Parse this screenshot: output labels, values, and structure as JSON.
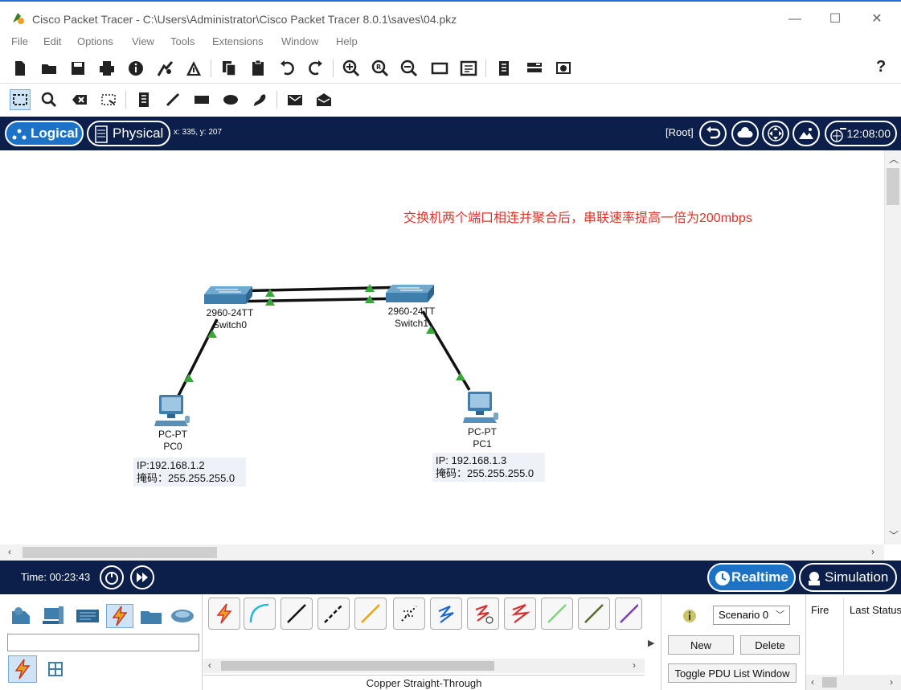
{
  "window": {
    "title": "Cisco Packet Tracer - C:\\Users\\Administrator\\Cisco Packet Tracer 8.0.1\\saves\\04.pkz",
    "minimize": "—",
    "maximize": "☐",
    "close": "✕"
  },
  "menu": [
    "File",
    "Edit",
    "Options",
    "View",
    "Tools",
    "Extensions",
    "Window",
    "Help"
  ],
  "toolbar": {
    "help": "?"
  },
  "workspace": {
    "logical_label": "Logical",
    "physical_label": "Physical",
    "coords": "x: 335, y: 207",
    "root_label": "[Root]",
    "clock": "12:08:00"
  },
  "canvas": {
    "note": "交换机两个端口相连并聚合后，串联速率提高一倍为200mbps",
    "switch0": {
      "model": "2960-24TT",
      "name": "Switch0"
    },
    "switch1": {
      "model": "2960-24TT",
      "name": "Switch1"
    },
    "pc0": {
      "model": "PC-PT",
      "name": "PC0",
      "ip": "IP:192.168.1.2",
      "mask": "掩码：255.255.255.0"
    },
    "pc1": {
      "model": "PC-PT",
      "name": "PC1",
      "ip": "IP:  192.168.1.3",
      "mask": "掩码：255.255.255.0"
    }
  },
  "statusbar": {
    "time": "Time: 00:23:43",
    "realtime_label": "Realtime",
    "simulation_label": "Simulation"
  },
  "bottom": {
    "connection_name": "Copper Straight-Through",
    "scenario": "Scenario 0",
    "new_label": "New",
    "delete_label": "Delete",
    "toggle_label": "Toggle PDU List Window",
    "pdu_headers": [
      "Fire",
      "Last Status"
    ]
  },
  "colors": {
    "header_bg": "#0b1f4a",
    "accent": "#1b72c6",
    "link_up": "#3ba63b",
    "note_red": "#e0342b"
  }
}
